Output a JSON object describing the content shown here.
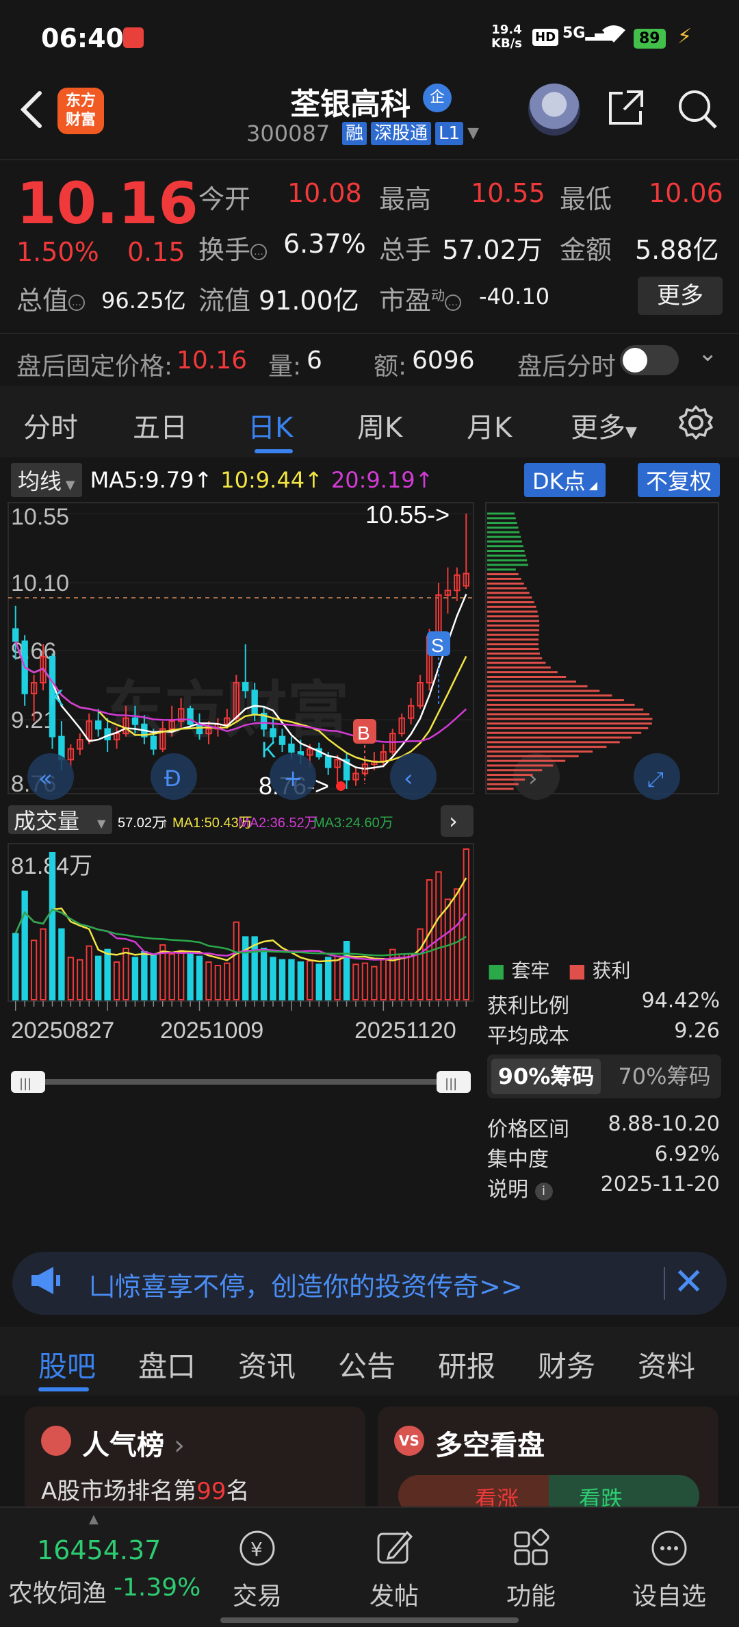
{
  "status_bar": {
    "time": "06:40",
    "net_speed": "19.4",
    "net_unit": "KB/s",
    "hd": "HD",
    "signal": "5G",
    "battery": "89"
  },
  "header": {
    "app_logo_line1": "东方",
    "app_logo_line2": "财富",
    "stock_name": "荃银高科",
    "badge_qi": "企",
    "code": "300087",
    "tags": [
      "融",
      "深股通",
      "L1"
    ]
  },
  "quote": {
    "price": "10.16",
    "change_pct": "1.50%",
    "change": "0.15",
    "open_label": "今开",
    "open": "10.08",
    "high_label": "最高",
    "high": "10.55",
    "low_label": "最低",
    "low": "10.06",
    "turnover_label": "换手",
    "turnover": "6.37%",
    "volume_label": "总手",
    "volume": "57.02万",
    "amount_label": "金额",
    "amount": "5.88亿",
    "mktcap_label": "总值",
    "mktcap": "96.25亿",
    "float_label": "流值",
    "float": "91.00亿",
    "pe_label": "市盈",
    "pe_sup": "动",
    "pe": "-40.10",
    "more": "更多"
  },
  "after_hours": {
    "label": "盘后固定价格:",
    "price": "10.16",
    "vol_label": "量:",
    "vol": "6",
    "amt_label": "额:",
    "amt": "6096",
    "toggle_label": "盘后分时"
  },
  "k_tabs": [
    "分时",
    "五日",
    "日K",
    "周K",
    "月K",
    "更多"
  ],
  "k_tab_active": "日K",
  "ma_bar": {
    "selector": "均线",
    "ma5": "MA5:9.79",
    "ma10": "10:9.44",
    "ma20": "20:9.19",
    "dk": "DK点",
    "fq": "不复权"
  },
  "colors": {
    "up": "#f0393a",
    "down": "#1fd0e0",
    "ma5": "#ffffff",
    "ma10": "#f2e543",
    "ma20": "#d33bd6",
    "ma30": "#2aa84a",
    "accent": "#3a82f0"
  },
  "main_chart": {
    "y_labels": [
      "10.55",
      "10.10",
      "9.66",
      "9.21",
      "8.76"
    ],
    "max_marker": "10.55->",
    "min_marker": "8.76->",
    "current_price_line": "10.10",
    "watermark": "东方财富",
    "signals": [
      {
        "text": "K"
      },
      {
        "text": "K"
      },
      {
        "text": "B"
      },
      {
        "text": "S"
      }
    ]
  },
  "volume_bar": {
    "selector": "成交量",
    "vol": "57.02万",
    "ma1": "MA1:50.43万",
    "ma2": "MA2:36.52万",
    "ma3": "MA3:24.60万",
    "max_label": "81.84万",
    "dates": [
      "20250827",
      "20251009",
      "20251120"
    ]
  },
  "chart_data": {
    "type": "candlestick",
    "title": "荃银高科 日K",
    "ylim": [
      8.76,
      10.55
    ],
    "candles": [
      [
        9.8,
        9.95,
        9.6,
        9.72
      ],
      [
        9.72,
        9.76,
        9.3,
        9.38
      ],
      [
        9.38,
        9.5,
        9.2,
        9.45
      ],
      [
        9.45,
        9.7,
        9.4,
        9.62
      ],
      [
        9.62,
        9.64,
        9.02,
        9.1
      ],
      [
        9.1,
        9.2,
        8.88,
        8.95
      ],
      [
        8.95,
        9.05,
        8.9,
        9.02
      ],
      [
        9.02,
        9.12,
        8.98,
        9.08
      ],
      [
        9.08,
        9.25,
        9.05,
        9.2
      ],
      [
        9.2,
        9.28,
        9.1,
        9.15
      ],
      [
        9.15,
        9.22,
        9.0,
        9.08
      ],
      [
        9.08,
        9.16,
        9.02,
        9.12
      ],
      [
        9.12,
        9.3,
        9.1,
        9.22
      ],
      [
        9.22,
        9.3,
        9.12,
        9.18
      ],
      [
        9.18,
        9.24,
        9.05,
        9.1
      ],
      [
        9.1,
        9.15,
        8.98,
        9.02
      ],
      [
        9.02,
        9.2,
        9.0,
        9.15
      ],
      [
        9.15,
        9.3,
        9.1,
        9.2
      ],
      [
        9.2,
        9.35,
        9.15,
        9.28
      ],
      [
        9.28,
        9.3,
        9.15,
        9.18
      ],
      [
        9.18,
        9.25,
        9.08,
        9.12
      ],
      [
        9.12,
        9.2,
        9.05,
        9.15
      ],
      [
        9.15,
        9.22,
        9.1,
        9.18
      ],
      [
        9.18,
        9.28,
        9.15,
        9.22
      ],
      [
        9.22,
        9.5,
        9.2,
        9.45
      ],
      [
        9.45,
        9.7,
        9.35,
        9.4
      ],
      [
        9.4,
        9.45,
        9.2,
        9.25
      ],
      [
        9.25,
        9.3,
        9.1,
        9.15
      ],
      [
        9.15,
        9.22,
        9.05,
        9.1
      ],
      [
        9.1,
        9.15,
        9.0,
        9.05
      ],
      [
        9.05,
        9.1,
        8.95,
        9.0
      ],
      [
        9.0,
        9.08,
        8.92,
        8.98
      ],
      [
        8.98,
        9.05,
        8.9,
        9.02
      ],
      [
        9.02,
        9.06,
        8.95,
        8.97
      ],
      [
        8.97,
        9.0,
        8.85,
        8.9
      ],
      [
        8.9,
        8.98,
        8.8,
        8.95
      ],
      [
        8.95,
        8.99,
        8.76,
        8.82
      ],
      [
        8.82,
        8.9,
        8.78,
        8.86
      ],
      [
        8.86,
        8.95,
        8.84,
        8.92
      ],
      [
        8.92,
        9.0,
        8.88,
        8.94
      ],
      [
        8.94,
        9.05,
        8.9,
        9.0
      ],
      [
        9.0,
        9.15,
        8.98,
        9.12
      ],
      [
        9.12,
        9.25,
        9.1,
        9.22
      ],
      [
        9.22,
        9.35,
        9.18,
        9.3
      ],
      [
        9.3,
        9.5,
        9.28,
        9.45
      ],
      [
        9.45,
        9.8,
        9.4,
        9.75
      ],
      [
        9.75,
        10.1,
        9.7,
        10.02
      ],
      [
        10.02,
        10.2,
        9.9,
        10.05
      ],
      [
        10.05,
        10.2,
        9.98,
        10.15
      ],
      [
        10.08,
        10.55,
        10.06,
        10.16
      ]
    ],
    "ma": [
      {
        "name": "MA5",
        "value": 9.79
      },
      {
        "name": "MA10",
        "value": 9.44
      },
      {
        "name": "MA20",
        "value": 9.19
      }
    ]
  },
  "chip_panel": {
    "legend_trapped": "套牢",
    "legend_profit": "获利",
    "rows": [
      {
        "label": "获利比例",
        "value": "94.42%"
      },
      {
        "label": "平均成本",
        "value": "9.26"
      }
    ],
    "btn90": "90%筹码",
    "btn70": "70%筹码",
    "rows2": [
      {
        "label": "价格区间",
        "value": "8.88-10.20"
      },
      {
        "label": "集中度",
        "value": "6.92%"
      },
      {
        "label": "说明",
        "value": "2025-11-20"
      }
    ]
  },
  "banner": {
    "text": "凵惊喜享不停，创造你的投资传奇>>"
  },
  "news_tabs": [
    "股吧",
    "盘口",
    "资讯",
    "公告",
    "研报",
    "财务",
    "资料"
  ],
  "cards": {
    "left_title": "人气榜",
    "left_sub_prefix": "A股市场排名第",
    "left_rank": "99",
    "left_sub_suffix": "名",
    "right_title": "多空看盘",
    "bull": "看涨",
    "bear": "看跌"
  },
  "bottom_nav": {
    "index_value": "16454.37",
    "index_name": "农牧饲渔",
    "index_change": "-1.39%",
    "items": [
      "交易",
      "发帖",
      "功能",
      "设自选"
    ]
  }
}
